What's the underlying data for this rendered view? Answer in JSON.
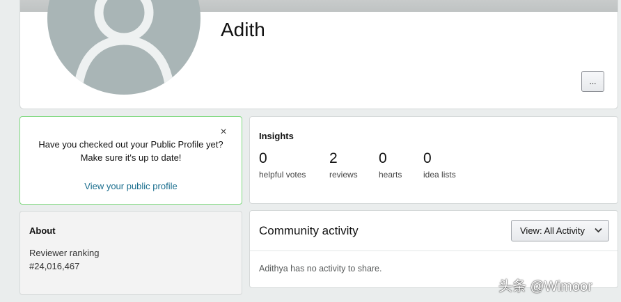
{
  "profile": {
    "name": "Adith",
    "more_button_label": "..."
  },
  "notice": {
    "close_symbol": "×",
    "line1": "Have you checked out your Public Profile yet?",
    "line2": "Make sure it's up to date!",
    "link_text": "View your public profile"
  },
  "insights": {
    "title": "Insights",
    "stats": [
      {
        "value": "0",
        "label": "helpful votes"
      },
      {
        "value": "2",
        "label": "reviews"
      },
      {
        "value": "0",
        "label": "hearts"
      },
      {
        "value": "0",
        "label": "idea lists"
      }
    ]
  },
  "about": {
    "title": "About",
    "ranking_label": "Reviewer ranking",
    "ranking_value": "#24,016,467"
  },
  "activity": {
    "title": "Community activity",
    "view_select": "View:  All Activity",
    "empty_message": "Adithya has no activity to share."
  },
  "watermark": {
    "text": "头条 @Wimoor"
  },
  "colors": {
    "background": "#eaeded",
    "avatar": "#a9b5b6",
    "notice_border": "#7fd97f",
    "link": "#1a6e8e"
  }
}
